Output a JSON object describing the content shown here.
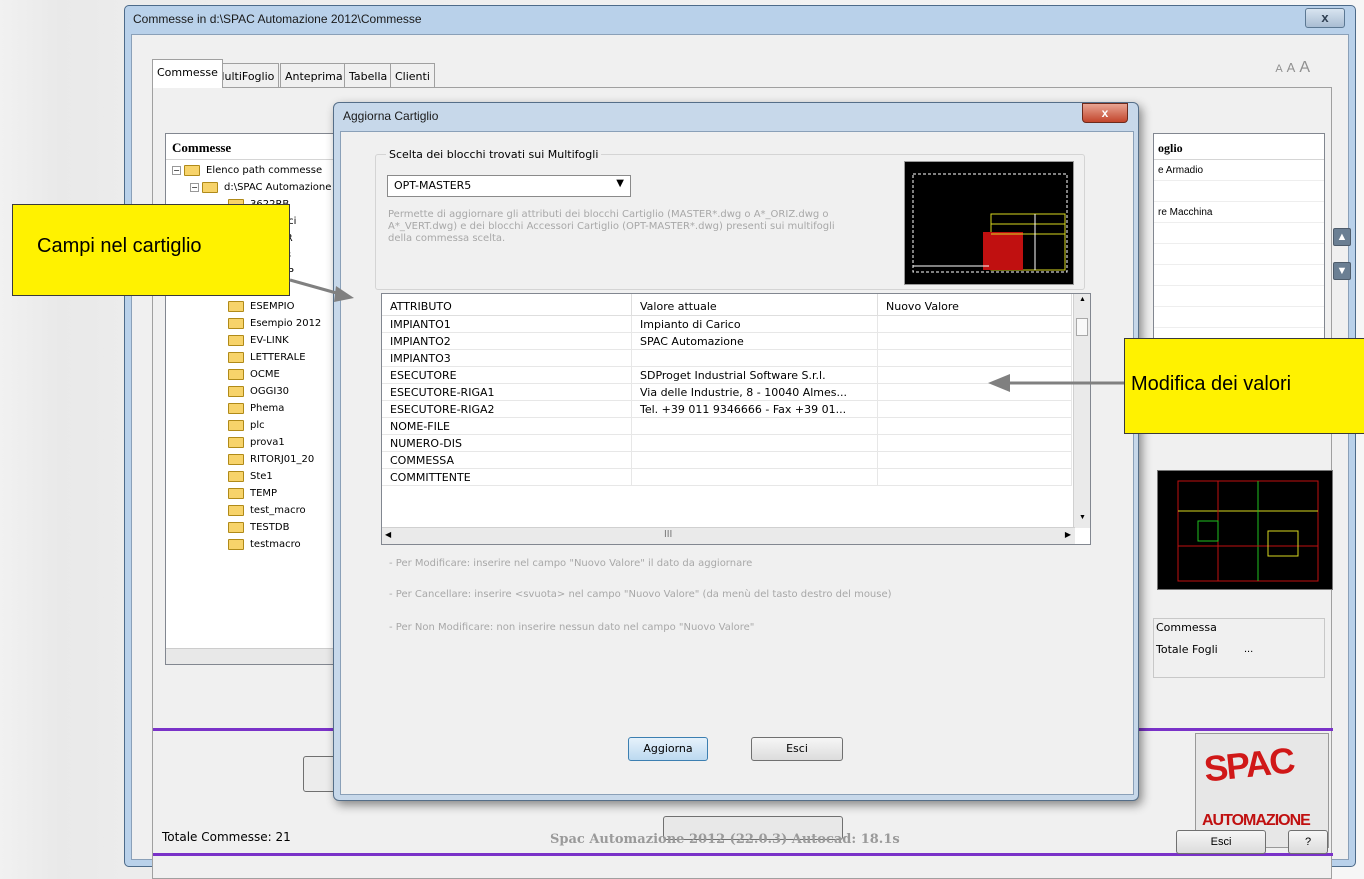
{
  "main_window": {
    "title": "Commesse in d:\\SPAC Automazione 2012\\Commesse",
    "close_label": "x",
    "tabs": [
      "Commesse",
      "MultiFoglio",
      "Anteprima",
      "Tabella",
      "Clienti"
    ],
    "font_size_labels": [
      "A",
      "A",
      "A"
    ],
    "tree": {
      "header": "Commesse",
      "root_label": "Elenco path commesse",
      "path_label": "d:\\SPAC Automazione",
      "items": [
        "3622RB",
        "Costrucci",
        "...ENTER",
        "...QDR.3",
        "...MX6SP",
        "...Croce",
        "ESEMPIO",
        "Esempio 2012",
        "EV-LINK",
        "LETTERALE",
        "OCME",
        "OGGI30",
        "Phema",
        "plc",
        "prova1",
        "RITORJ01_20",
        "Ste1",
        "TEMP",
        "test_macro",
        "TESTDB",
        "testmacro"
      ]
    },
    "right_list": {
      "header": "oglio",
      "rows": [
        "e Armadio",
        "",
        "re Macchina",
        "",
        "",
        "",
        "",
        "",
        "",
        "",
        "",
        ""
      ]
    },
    "info": {
      "commessa_label": "Commessa",
      "totale_fogli_label": "Totale Fogli",
      "totale_fogli_value": "..."
    },
    "logo": {
      "line1": "SPAC",
      "line2": "AUTOMAZIONE"
    },
    "status_left": "Totale Commesse: 21",
    "status_center": "Spac Automazione 2012  (22.0.3)  Autocad: 18.1s",
    "esci_label": "Esci",
    "help_label": "?"
  },
  "dialog": {
    "title": "Aggiorna Cartiglio",
    "close_label": "x",
    "group_label": "Scelta dei blocchi trovati sui Multifogli",
    "combo_value": "OPT-MASTER5",
    "description": "Permette di aggiornare gli attributi dei blocchi Cartiglio (MASTER*.dwg o A*_ORIZ.dwg o A*_VERT.dwg) e dei blocchi Accessori Cartiglio (OPT-MASTER*.dwg) presenti sui multifogli della commessa scelta.",
    "grid": {
      "columns": [
        "ATTRIBUTO",
        "Valore attuale",
        "Nuovo Valore"
      ],
      "rows": [
        [
          "IMPIANTO1",
          "Impianto di Carico",
          ""
        ],
        [
          "IMPIANTO2",
          "SPAC Automazione",
          ""
        ],
        [
          "IMPIANTO3",
          "",
          ""
        ],
        [
          "ESECUTORE",
          "SDProget Industrial Software S.r.l.",
          ""
        ],
        [
          "ESECUTORE-RIGA1",
          "Via delle Industrie, 8 - 10040 Almes...",
          ""
        ],
        [
          "ESECUTORE-RIGA2",
          "Tel. +39 011 9346666 - Fax +39 01...",
          ""
        ],
        [
          "NOME-FILE",
          "",
          ""
        ],
        [
          "NUMERO-DIS",
          "",
          ""
        ],
        [
          "COMMESSA",
          "",
          ""
        ],
        [
          "COMMITTENTE",
          "",
          ""
        ]
      ],
      "hscroll_label": "III"
    },
    "hints": [
      "- Per Modificare: inserire nel campo \"Nuovo Valore\" il dato da aggiornare",
      "- Per Cancellare: inserire <svuota> nel campo \"Nuovo Valore\" (da menù del tasto destro del mouse)",
      "- Per Non Modificare: non inserire nessun dato nel campo \"Nuovo Valore\""
    ],
    "update_label": "Aggiorna",
    "exit_label": "Esci"
  },
  "callouts": {
    "left": "Campi nel cartiglio",
    "right": "Modifica dei valori"
  },
  "colors": {
    "callout": "#fff200",
    "accent_purple": "#7a32c8"
  }
}
